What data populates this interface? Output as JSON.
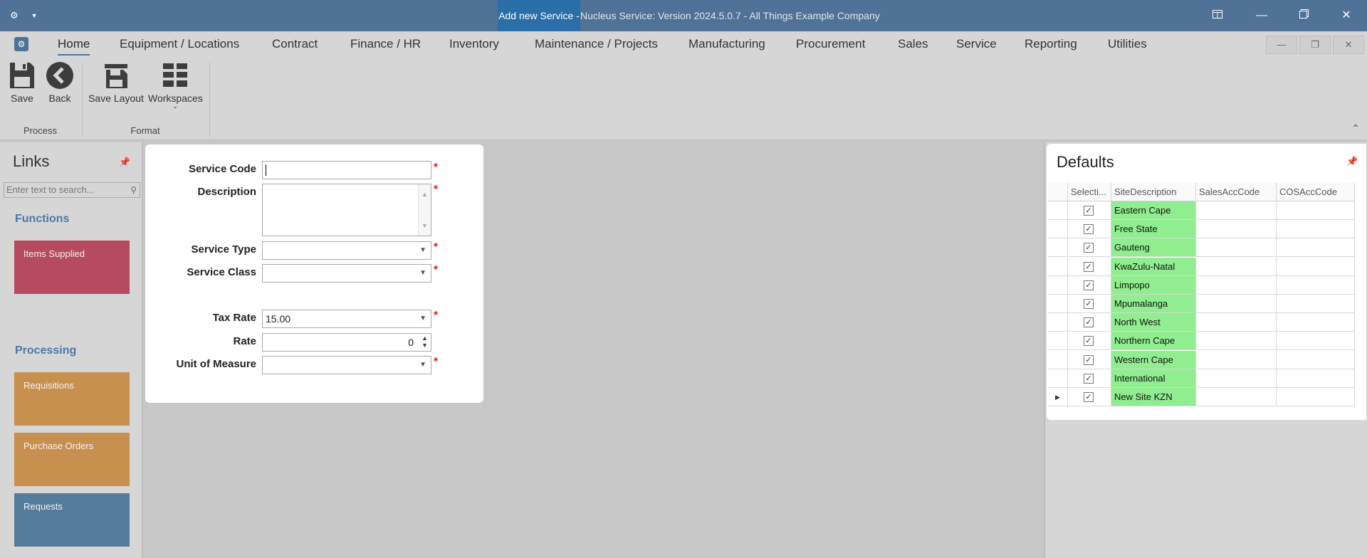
{
  "window": {
    "highlight": "Add new Service -",
    "title": "Nucleus Service: Version 2024.5.0.7 - All Things Example Company",
    "app_icon": "gear-icon",
    "controls": [
      "restore-layout-icon",
      "minimize-icon",
      "maximize-icon",
      "close-icon"
    ]
  },
  "menu": {
    "items": [
      "Home",
      "Equipment / Locations",
      "Contract",
      "Finance / HR",
      "Inventory",
      "Maintenance / Projects",
      "Manufacturing",
      "Procurement",
      "Sales",
      "Service",
      "Reporting",
      "Utilities"
    ],
    "active": "Home"
  },
  "ribbon": {
    "save": "Save",
    "back": "Back",
    "save_layout": "Save Layout",
    "workspaces": "Workspaces",
    "group_process": "Process",
    "group_format": "Format"
  },
  "links": {
    "title": "Links",
    "search_placeholder": "Enter text to search...",
    "functions_header": "Functions",
    "functions": [
      {
        "label": "Items Supplied",
        "color": "#b64a5e"
      }
    ],
    "processing_header": "Processing",
    "processing": [
      {
        "label": "Requisitions",
        "color": "#c8904f"
      },
      {
        "label": "Purchase Orders",
        "color": "#c8904f"
      },
      {
        "label": "Requests",
        "color": "#557c9a"
      }
    ]
  },
  "form": {
    "service_code_label": "Service Code",
    "service_code_value": "",
    "description_label": "Description",
    "description_value": "",
    "service_type_label": "Service Type",
    "service_type_value": "",
    "service_class_label": "Service Class",
    "service_class_value": "",
    "tax_rate_label": "Tax Rate",
    "tax_rate_value": "15.00",
    "rate_label": "Rate",
    "rate_value": "0",
    "uom_label": "Unit of Measure",
    "uom_value": "",
    "required_marker": "*"
  },
  "defaults": {
    "title": "Defaults",
    "columns": [
      "Selecti...",
      "SiteDescription",
      "SalesAccCode",
      "COSAccCode"
    ],
    "rows": [
      {
        "selected": true,
        "site": "Eastern Cape",
        "sales": "",
        "cos": ""
      },
      {
        "selected": true,
        "site": "Free State",
        "sales": "",
        "cos": ""
      },
      {
        "selected": true,
        "site": "Gauteng",
        "sales": "",
        "cos": ""
      },
      {
        "selected": true,
        "site": "KwaZulu-Natal",
        "sales": "",
        "cos": ""
      },
      {
        "selected": true,
        "site": "Limpopo",
        "sales": "",
        "cos": ""
      },
      {
        "selected": true,
        "site": "Mpumalanga",
        "sales": "",
        "cos": ""
      },
      {
        "selected": true,
        "site": "North West",
        "sales": "",
        "cos": ""
      },
      {
        "selected": true,
        "site": "Northern Cape",
        "sales": "",
        "cos": ""
      },
      {
        "selected": true,
        "site": "Western Cape",
        "sales": "",
        "cos": ""
      },
      {
        "selected": true,
        "site": "International",
        "sales": "",
        "cos": ""
      },
      {
        "selected": true,
        "site": "New Site KZN",
        "sales": "",
        "cos": "",
        "current": true
      }
    ],
    "check_mark": "✓",
    "site_color": "#90ee90"
  }
}
